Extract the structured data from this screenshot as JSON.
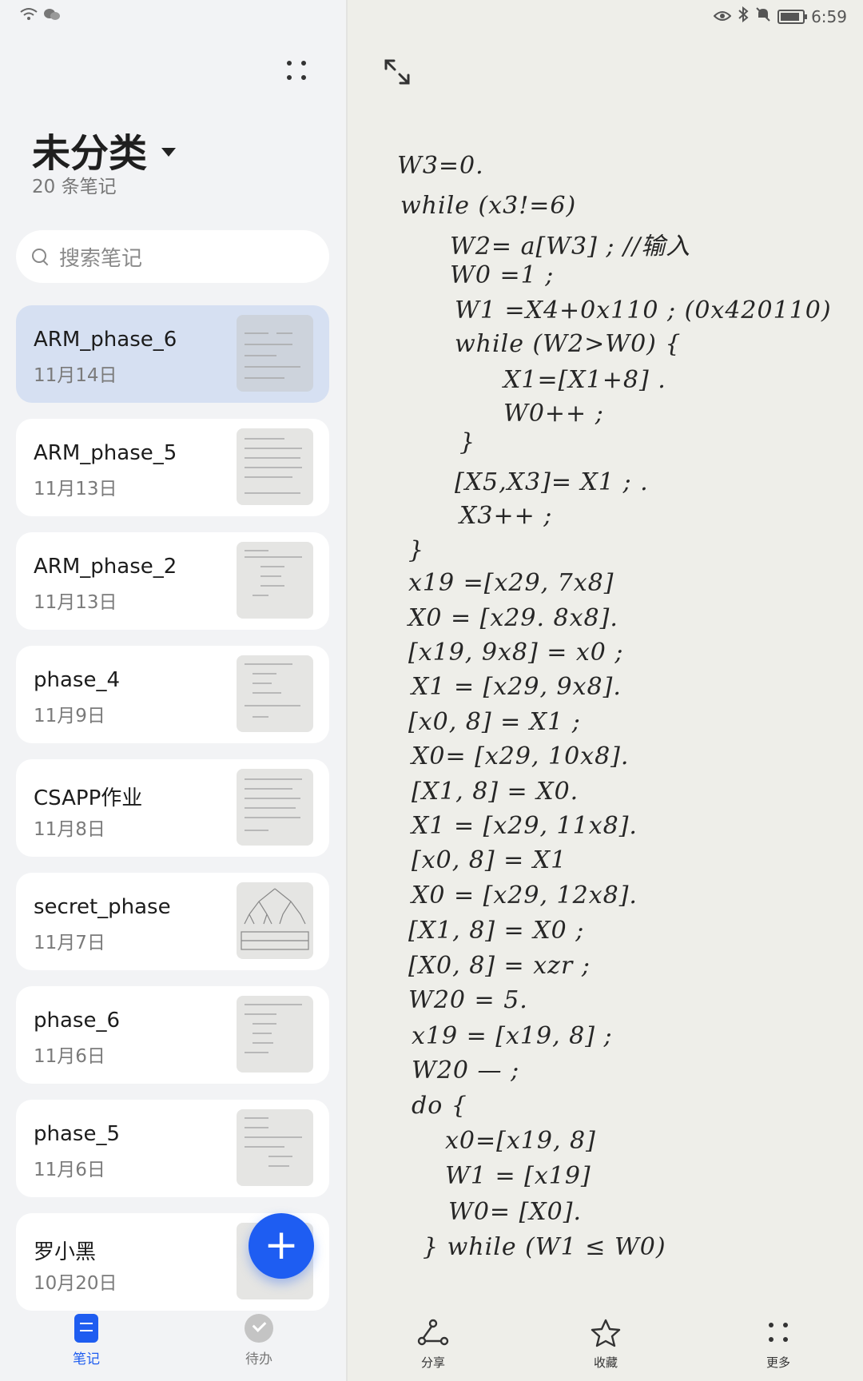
{
  "status_bar": {
    "time": "6:59"
  },
  "sidebar": {
    "folder_name": "未分类",
    "note_count": "20 条笔记",
    "search_placeholder": "搜索笔记",
    "notes": [
      {
        "title": "ARM_phase_6",
        "date": "11月14日"
      },
      {
        "title": "ARM_phase_5",
        "date": "11月13日"
      },
      {
        "title": "ARM_phase_2",
        "date": "11月13日"
      },
      {
        "title": "phase_4",
        "date": "11月9日"
      },
      {
        "title": "CSAPP作业",
        "date": "11月8日"
      },
      {
        "title": "secret_phase",
        "date": "11月7日"
      },
      {
        "title": "phase_6",
        "date": "11月6日"
      },
      {
        "title": "phase_5",
        "date": "11月6日"
      },
      {
        "title": "罗小黑",
        "date": "10月20日"
      }
    ],
    "fab_label": "+"
  },
  "bottom_nav": {
    "notes_label": "笔记",
    "todo_label": "待办"
  },
  "note_content": {
    "lines": [
      "W3=0.",
      "while (x3!=6)",
      "W2= a[W3] ;  //输入",
      "W0 =1 ;",
      "W1 =X4+0x110 ; (0x420110)",
      "while (W2>W0) {",
      "X1=[X1+8] .",
      "W0++ ;",
      "}",
      "[X5,X3]= X1 ; .",
      "X3++ ;",
      "}",
      "x19 =[x29, 7x8]",
      "X0 = [x29. 8x8].",
      "[x19, 9x8] = x0 ;",
      "X1 = [x29, 9x8].",
      "[x0, 8] = X1 ;",
      "X0= [x29, 10x8].",
      "[X1, 8] = X0.",
      "X1 = [x29, 11x8].",
      "[x0, 8] = X1",
      "X0 = [x29, 12x8].",
      "[X1, 8] = X0 ;",
      "[X0, 8] = xzr ;",
      "W20 = 5.",
      "x19 = [x19, 8] ;",
      "W20 — ;",
      "do {",
      "x0=[x19, 8]",
      "W1 = [x19]",
      "W0= [X0].",
      "} while (W1 ≤ W0)"
    ]
  },
  "toolbar": {
    "share_label": "分享",
    "favorite_label": "收藏",
    "more_label": "更多"
  }
}
